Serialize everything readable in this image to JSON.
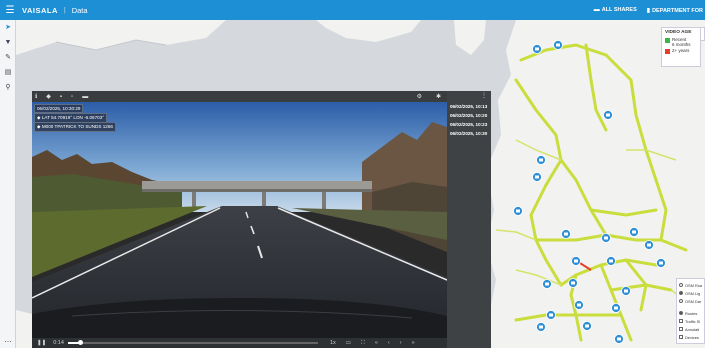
{
  "topbar": {
    "brand": "VAISALA",
    "separator": "|",
    "title": "Data",
    "links": [
      {
        "icon": "folder-icon",
        "label": "ALL SHARES"
      },
      {
        "icon": "building-icon",
        "label": "DEPARTMENT FOR"
      }
    ]
  },
  "video": {
    "overlay": {
      "datetime": "06/02/2025, 10:30:29",
      "lat": "LAT 54.70919°",
      "lon": "LON -6.06703°",
      "id": "M000",
      "route": "TPATRICK TO SUNDS",
      "extra": "1266"
    },
    "controls": {
      "time": "0:14",
      "speed": "1x"
    }
  },
  "timestamps": [
    "06/02/2025, 10:13",
    "06/02/2025, 10:20",
    "06/02/2025, 10:23",
    "06/02/2025, 10:30"
  ],
  "legend": {
    "title": "VIDEO AGE",
    "items": [
      {
        "label": "Recent",
        "sub": "6 months",
        "color": "#39b54a"
      },
      {
        "label": "2+ years",
        "sub": "",
        "color": "#e2402b"
      }
    ]
  },
  "layers": {
    "base": [
      {
        "label": "OSM Roa",
        "selected": false
      },
      {
        "label": "OSM Lig",
        "selected": true
      },
      {
        "label": "OSM Dar",
        "selected": false
      }
    ],
    "overlays": [
      {
        "label": "Routes",
        "checked": true
      },
      {
        "label": "Traffic Si",
        "checked": false
      },
      {
        "label": "Annotati",
        "checked": false
      },
      {
        "label": "Devices",
        "checked": false
      }
    ]
  },
  "colors": {
    "accent": "#1d8fd5",
    "route": "#c9dd3c",
    "marker": "#2f8fd6"
  }
}
